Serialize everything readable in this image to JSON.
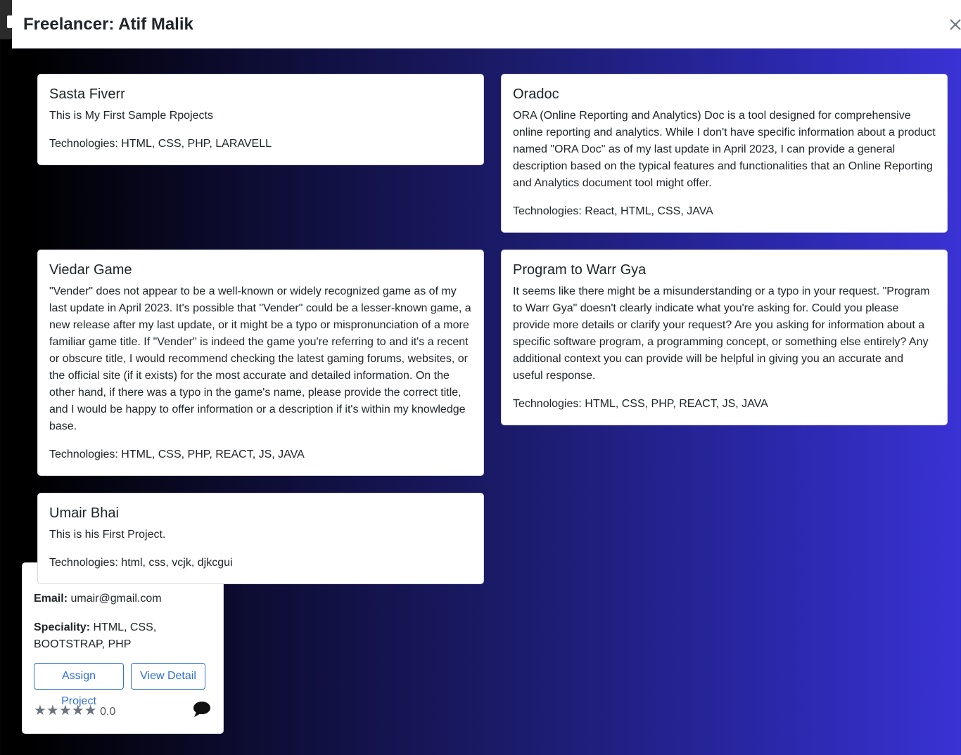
{
  "modal": {
    "title": "Freelancer: Atif Malik"
  },
  "projects": [
    {
      "title": "Sasta Fiverr",
      "description": "This is My First Sample Rpojects",
      "technologies": "Technologies: HTML, CSS, PHP, LARAVELL"
    },
    {
      "title": "Oradoc",
      "description": "ORA (Online Reporting and Analytics) Doc is a tool designed for comprehensive online reporting and analytics. While I don't have specific information about a product named \"ORA Doc\" as of my last update in April 2023, I can provide a general description based on the typical features and functionalities that an Online Reporting and Analytics document tool might offer.",
      "technologies": "Technologies: React, HTML, CSS, JAVA"
    },
    {
      "title": "Viedar Game",
      "description": "\"Vender\" does not appear to be a well-known or widely recognized game as of my last update in April 2023. It's possible that \"Vender\" could be a lesser-known game, a new release after my last update, or it might be a typo or mispronunciation of a more familiar game title. If \"Vender\" is indeed the game you're referring to and it's a recent or obscure title, I would recommend checking the latest gaming forums, websites, or the official site (if it exists) for the most accurate and detailed information. On the other hand, if there was a typo in the game's name, please provide the correct title, and I would be happy to offer information or a description if it's within my knowledge base.",
      "technologies": "Technologies: HTML, CSS, PHP, REACT, JS, JAVA"
    },
    {
      "title": "Program to Warr Gya",
      "description": "It seems like there might be a misunderstanding or a typo in your request. \"Program to Warr Gya\" doesn't clearly indicate what you're asking for. Could you please provide more details or clarify your request? Are you asking for information about a specific software program, a programming concept, or something else entirely? Any additional context you can provide will be helpful in giving you an accurate and useful response.",
      "technologies": "Technologies: HTML, CSS, PHP, REACT, JS, JAVA"
    },
    {
      "title": "Umair Bhai",
      "description": "This is his First Project.",
      "technologies": "Technologies: html, css, vcjk, djkcgui"
    }
  ],
  "background_card": {
    "email_label": "Email:",
    "email_value": "umair@gmail.com",
    "speciality_label": "Speciality:",
    "speciality_value": "HTML, CSS, BOOTSTRAP, PHP",
    "assign_button": "Assign Project",
    "view_button": "View Detail",
    "stars": "★★★★★",
    "rating": "0.0",
    "chat_icon": "chat-bubble-icon"
  },
  "colors": {
    "accent": "#2f6fd6",
    "gradient_end": "#3a32d4"
  }
}
